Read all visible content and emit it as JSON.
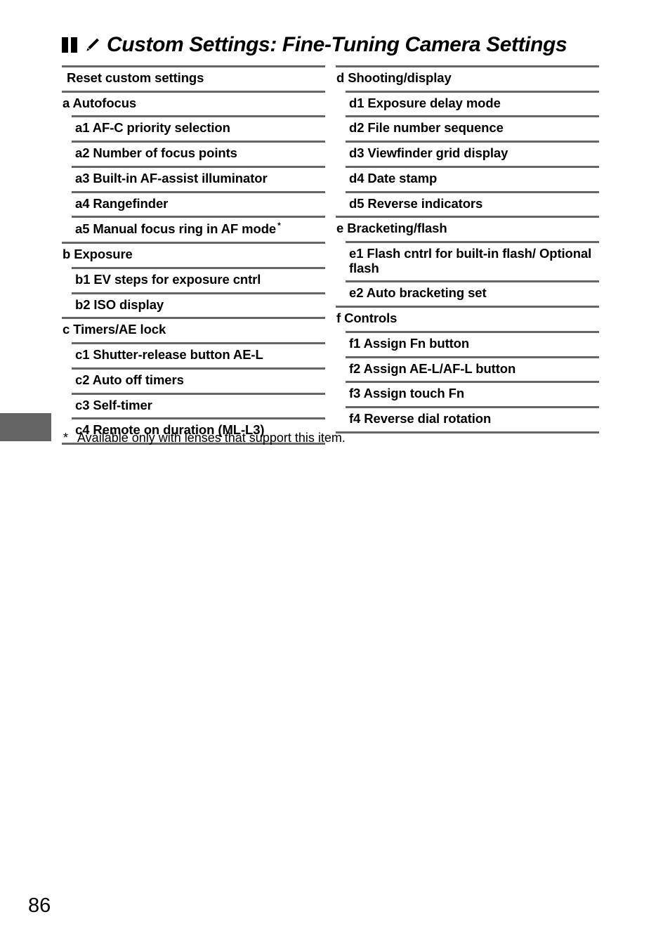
{
  "header": {
    "title": "Custom Settings: Fine-Tuning Camera Settings",
    "bookmark_icon": "bookmark-bars-icon",
    "pencil_icon": "pencil-icon"
  },
  "columns": {
    "left": [
      {
        "level": 0,
        "label": "Reset custom settings"
      },
      {
        "level": 1,
        "label": "a Autofocus"
      },
      {
        "level": 2,
        "label": "a1 AF-C priority selection"
      },
      {
        "level": 2,
        "label": "a2 Number of focus points"
      },
      {
        "level": 2,
        "label": "a3 Built-in AF-assist illuminator"
      },
      {
        "level": 2,
        "label": "a4 Rangefinder"
      },
      {
        "level": 2,
        "label": "a5 Manual focus ring in AF mode",
        "footnote_mark": "*"
      },
      {
        "level": 1,
        "label": "b Exposure"
      },
      {
        "level": 2,
        "label": "b1 EV steps for exposure cntrl"
      },
      {
        "level": 2,
        "label": "b2 ISO display"
      },
      {
        "level": 1,
        "label": "c Timers/AE lock"
      },
      {
        "level": 2,
        "label": "c1 Shutter-release button AE-L"
      },
      {
        "level": 2,
        "label": "c2 Auto off timers"
      },
      {
        "level": 2,
        "label": "c3 Self-timer"
      },
      {
        "level": 2,
        "label": "c4 Remote on duration (ML-L3)"
      }
    ],
    "right": [
      {
        "level": 1,
        "label": "d Shooting/display"
      },
      {
        "level": 2,
        "label": "d1 Exposure delay mode"
      },
      {
        "level": 2,
        "label": "d2 File number sequence"
      },
      {
        "level": 2,
        "label": "d3 Viewfinder grid display"
      },
      {
        "level": 2,
        "label": "d4 Date stamp"
      },
      {
        "level": 2,
        "label": "d5 Reverse indicators"
      },
      {
        "level": 1,
        "label": "e Bracketing/flash"
      },
      {
        "level": 2,
        "label": "e1 Flash cntrl for built-in flash/ Optional flash"
      },
      {
        "level": 2,
        "label": "e2 Auto bracketing set"
      },
      {
        "level": 1,
        "label": "f Controls"
      },
      {
        "level": 2,
        "label": "f1 Assign Fn button"
      },
      {
        "level": 2,
        "label": "f2 Assign AE-L/AF-L button"
      },
      {
        "level": 2,
        "label": "f3 Assign touch Fn"
      },
      {
        "level": 2,
        "label": "f4 Reverse dial rotation"
      }
    ]
  },
  "footnote": {
    "mark": "*",
    "text": "Available only with lenses that support this item."
  },
  "page_number": "86",
  "colors": {
    "rule": "#656565",
    "side_tab": "#656565",
    "text": "#000000"
  }
}
